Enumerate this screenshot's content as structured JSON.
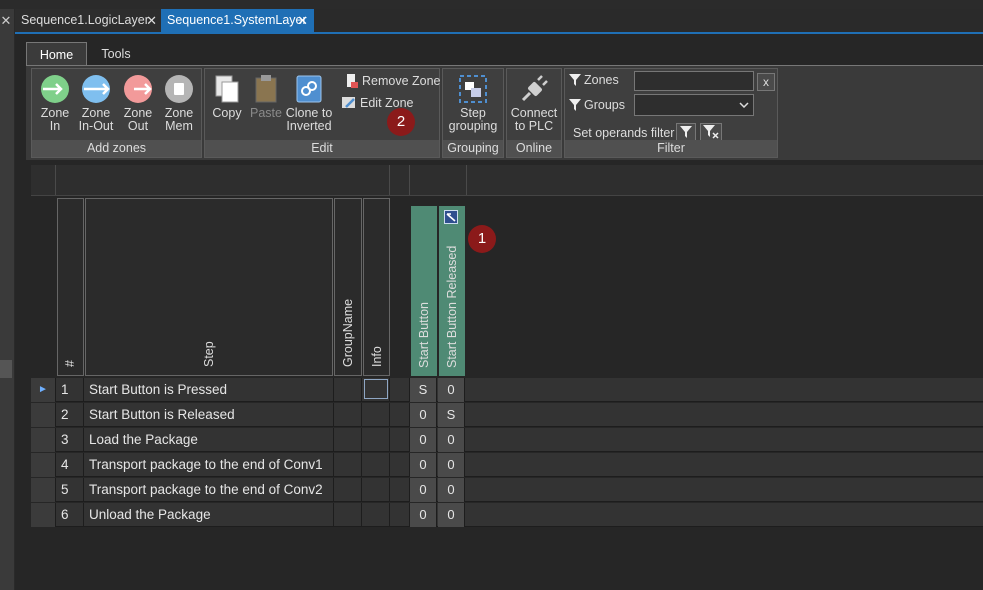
{
  "tabs": [
    {
      "label": "Sequence1.LogicLayer",
      "close": "✕"
    },
    {
      "label": "Sequence1.SystemLayer",
      "close": "✕"
    }
  ],
  "left_close": "✕",
  "ribbon": {
    "tabs": [
      "Home",
      "Tools"
    ],
    "groups": {
      "add_zones": {
        "label": "Add zones",
        "buttons": [
          {
            "label1": "Zone",
            "label2": "In",
            "icon": "zone-in-icon",
            "color": "#7fd08a"
          },
          {
            "label1": "Zone",
            "label2": "In-Out",
            "icon": "zone-in-out-icon",
            "color": "#7fbfef"
          },
          {
            "label1": "Zone",
            "label2": "Out",
            "icon": "zone-out-icon",
            "color": "#f29a9a"
          },
          {
            "label1": "Zone",
            "label2": "Mem",
            "icon": "zone-mem-icon",
            "color": "#b5b5b5"
          }
        ]
      },
      "edit": {
        "label": "Edit",
        "copy": "Copy",
        "paste": "Paste",
        "clone1": "Clone to",
        "clone2": "Inverted",
        "remove_zone": "Remove Zone",
        "edit_zone": "Edit Zone"
      },
      "grouping": {
        "label": "Grouping",
        "btn1": "Step",
        "btn2": "grouping"
      },
      "online": {
        "label": "Online",
        "btn1": "Connect",
        "btn2": "to PLC"
      },
      "filter": {
        "label": "Filter",
        "zones_label": "Zones",
        "groups_label": "Groups",
        "clear": "x",
        "set_operands": "Set operands filter"
      }
    }
  },
  "grid": {
    "columns": {
      "index": "#",
      "step": "Step",
      "group": "GroupName",
      "info": "Info"
    },
    "zone_columns": [
      "Start Button",
      "Start Button Released"
    ],
    "rows": [
      {
        "n": "1",
        "step": "Start Button is Pressed",
        "z1": "S",
        "z2": "0"
      },
      {
        "n": "2",
        "step": "Start Button is Released",
        "z1": "0",
        "z2": "S"
      },
      {
        "n": "3",
        "step": "Load the Package",
        "z1": "0",
        "z2": "0"
      },
      {
        "n": "4",
        "step": "Transport package to the end of Conv1",
        "z1": "0",
        "z2": "0"
      },
      {
        "n": "5",
        "step": "Transport package to the end of Conv2",
        "z1": "0",
        "z2": "0"
      },
      {
        "n": "6",
        "step": "Unload the Package",
        "z1": "0",
        "z2": "0"
      }
    ],
    "current_row_marker": "►"
  },
  "badges": [
    "1",
    "2"
  ]
}
